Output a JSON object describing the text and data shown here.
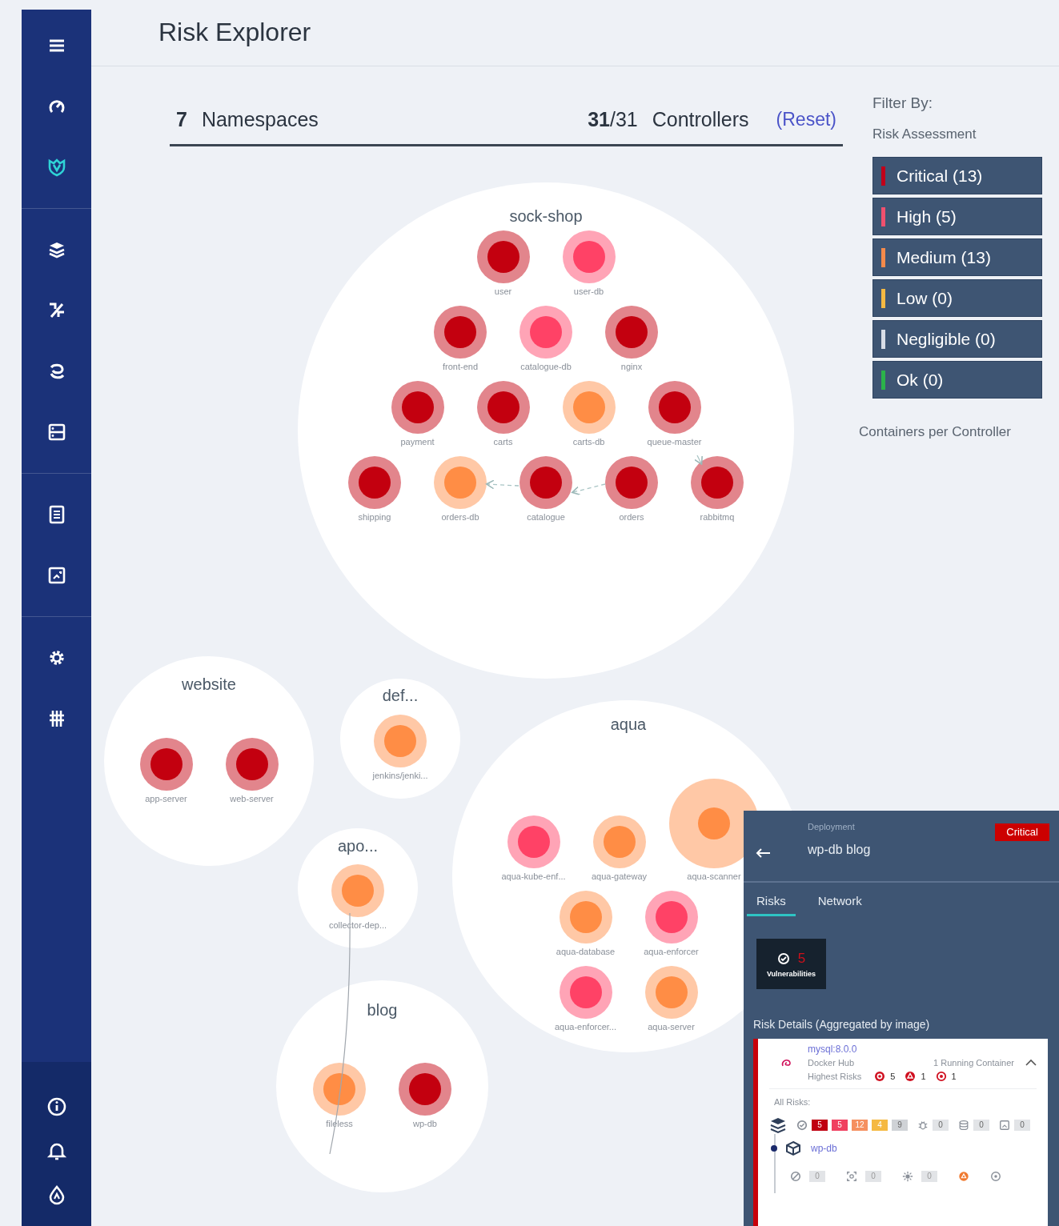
{
  "sidebar": {
    "groups": [
      [
        {
          "kind": "menu",
          "selected": false
        },
        {
          "kind": "gauge",
          "selected": false
        },
        {
          "kind": "shield",
          "selected": true
        }
      ],
      [
        {
          "kind": "layers",
          "selected": false
        },
        {
          "kind": "percent",
          "selected": false
        },
        {
          "kind": "swirl",
          "selected": false
        },
        {
          "kind": "server",
          "selected": false
        }
      ],
      [
        {
          "kind": "document",
          "selected": false
        },
        {
          "kind": "image",
          "selected": false
        }
      ],
      [
        {
          "kind": "gear",
          "selected": false
        },
        {
          "kind": "grid",
          "selected": false
        }
      ]
    ],
    "bottom": [
      {
        "kind": "info",
        "selected": false
      },
      {
        "kind": "bell",
        "selected": false
      },
      {
        "kind": "drop",
        "selected": false
      }
    ]
  },
  "header": {
    "title": "Risk Explorer"
  },
  "summary": {
    "namespace_count": "7",
    "namespaces_label": "Namespaces",
    "controllers_count": "**31**/31",
    "controllers_label": "Controllers",
    "reset": "(Reset)"
  },
  "filter": {
    "title": "Filter By:",
    "subtitle": "Risk Assessment",
    "options": [
      {
        "label": "Critical (13)",
        "color": "#c0001a"
      },
      {
        "label": "High (5)",
        "color": "#f0506e"
      },
      {
        "label": "Medium (13)",
        "color": "#f58a4b"
      },
      {
        "label": "Low (0)",
        "color": "#f5b942"
      },
      {
        "label": "Negligible (0)",
        "color": "#d8dde6"
      },
      {
        "label": "Ok (0)",
        "color": "#2bb34a"
      }
    ],
    "size_label": "Containers per Controller"
  },
  "namespaces": [
    {
      "name": "sock-shop",
      "rows": [
        [
          {
            "name": "user",
            "color": "#c3000f"
          },
          {
            "name": "user-db",
            "color": "#ff4266"
          }
        ],
        [
          {
            "name": "front-end",
            "color": "#c3000f"
          },
          {
            "name": "catalogue-db",
            "color": "#ff4266"
          },
          {
            "name": "nginx",
            "color": "#c3000f"
          }
        ],
        [
          {
            "name": "payment",
            "color": "#c3000f"
          },
          {
            "name": "carts",
            "color": "#c3000f"
          },
          {
            "name": "carts-db",
            "color": "#ff8d45"
          },
          {
            "name": "queue-master",
            "color": "#c3000f"
          }
        ],
        [
          {
            "name": "shipping",
            "color": "#c3000f"
          },
          {
            "name": "orders-db",
            "color": "#ff8d45"
          },
          {
            "name": "catalogue",
            "color": "#c3000f"
          },
          {
            "name": "orders",
            "color": "#c3000f"
          },
          {
            "name": "rabbitmq",
            "color": "#c3000f"
          }
        ]
      ]
    },
    {
      "name": "website",
      "rows": [
        [
          {
            "name": "app-server",
            "color": "#c3000f"
          },
          {
            "name": "web-server",
            "color": "#c3000f"
          }
        ]
      ]
    },
    {
      "name": "def...",
      "rows": [
        [
          {
            "name": "jenkins/jenki...",
            "color": "#ff8d45"
          }
        ]
      ]
    },
    {
      "name": "apo...",
      "rows": [
        [
          {
            "name": "collector-dep...",
            "color": "#ff8d45"
          }
        ]
      ]
    },
    {
      "name": "blog",
      "rows": [
        [
          {
            "name": "fileless",
            "color": "#ff8d45"
          },
          {
            "name": "wp-db",
            "color": "#c3000f"
          }
        ]
      ]
    },
    {
      "name": "aqua",
      "rows": [
        [
          {
            "name": "aqua-kube-enf...",
            "color": "#ff4266",
            "large": false
          },
          {
            "name": "aqua-gateway",
            "color": "#ff8d45",
            "large": false
          },
          {
            "name": "aqua-scanner",
            "color": "#ff8d45",
            "large": true
          }
        ],
        [
          {
            "name": "aqua-database",
            "color": "#ff8d45",
            "large": false
          },
          {
            "name": "aqua-enforcer",
            "color": "#ff4266",
            "large": false
          }
        ],
        [
          {
            "name": "aqua-enforcer...",
            "color": "#ff4266",
            "large": false
          },
          {
            "name": "aqua-server",
            "color": "#ff8d45",
            "large": false
          }
        ]
      ]
    }
  ],
  "detail": {
    "label": "Deployment",
    "title": "wp-db blog",
    "badge": "Critical",
    "tabs": [
      {
        "label": "Risks",
        "selected": true
      },
      {
        "label": "Network",
        "selected": false
      }
    ],
    "tile": {
      "value": "5",
      "label": "Vulnerabilities"
    },
    "section_title": "Risk Details (Aggregated by image)",
    "image": {
      "name": "mysql:8.0.0",
      "registry": "Docker Hub",
      "containers": "1 Running Container",
      "expanded": true,
      "highest_label": "Highest Risks",
      "highest": [
        {
          "kind": "vulnerability",
          "value": "5"
        },
        {
          "kind": "malware",
          "value": "1"
        },
        {
          "kind": "target",
          "value": "1"
        }
      ],
      "all_label": "All Risks:",
      "all": [
        {
          "kind": "vulnerability",
          "counts": [
            {
              "value": "5",
              "color": "#c00010"
            },
            {
              "value": "5",
              "color": "#f04060"
            },
            {
              "value": "12",
              "color": "#f59060"
            },
            {
              "value": "4",
              "color": "#f5b942"
            },
            {
              "value": "9",
              "color": "#cfd2d6"
            }
          ]
        },
        {
          "kind": "bug",
          "counts": [
            {
              "value": "0",
              "color": "#e2e4e7"
            }
          ]
        },
        {
          "kind": "database",
          "counts": [
            {
              "value": "0",
              "color": "#e2e4e7"
            }
          ]
        },
        {
          "kind": "image",
          "counts": [
            {
              "value": "0",
              "color": "#e2e4e7"
            }
          ]
        }
      ],
      "container": {
        "name": "wp-db",
        "risks": [
          {
            "kind": "blocked",
            "value": "0"
          },
          {
            "kind": "scan",
            "value": "0"
          },
          {
            "kind": "sun",
            "value": "0"
          },
          {
            "kind": "warning"
          },
          {
            "kind": "target"
          }
        ]
      }
    }
  }
}
